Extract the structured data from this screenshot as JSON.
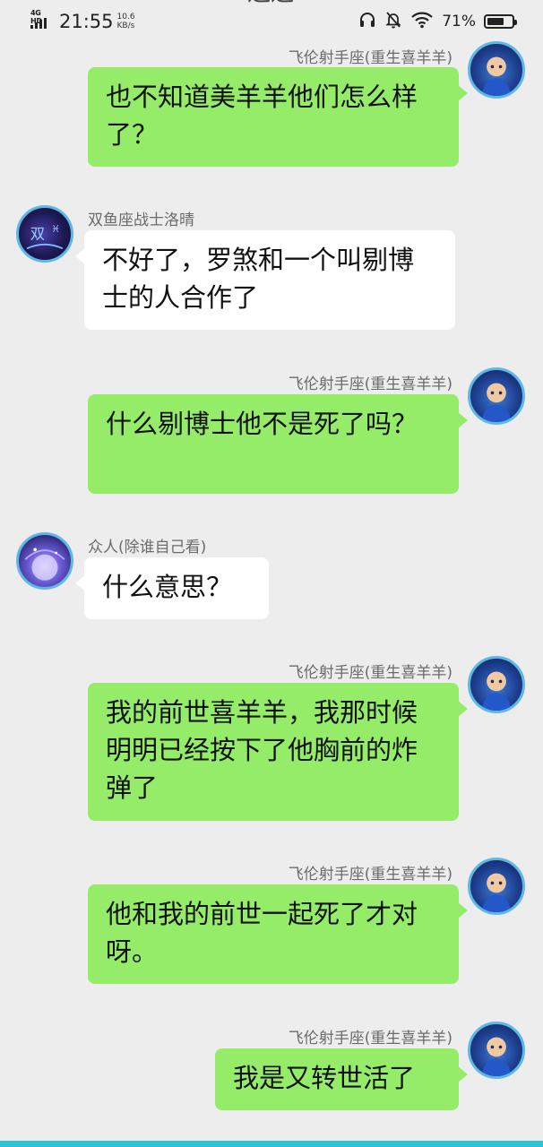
{
  "status_bar": {
    "network": "4G HD",
    "time": "21:55",
    "speed_value": "10.6",
    "speed_unit": "KB/s",
    "battery_pct": "71%",
    "battery_level": 0.71,
    "icons": [
      "headphones-icon",
      "bell-muted-icon",
      "wifi-icon",
      "battery-icon"
    ]
  },
  "chat": {
    "messages": [
      {
        "side": "right",
        "sender": "飞伦射手座(重生喜羊羊)",
        "text": "也不知道美羊羊他们怎么样了？",
        "avatar": "boy-avatar"
      },
      {
        "side": "left",
        "sender": "双鱼座战士洛晴",
        "text": "不好了，罗煞和一个叫剔博士的人合作了",
        "avatar": "pisces-avatar"
      },
      {
        "side": "right",
        "sender": "飞伦射手座(重生喜羊羊)",
        "text": "什么剔博士他不是死了吗？",
        "avatar": "boy-avatar"
      },
      {
        "side": "left",
        "sender": "众人(除谁自己看)",
        "text": "什么意思？",
        "avatar": "crowd-avatar"
      },
      {
        "side": "right",
        "sender": "飞伦射手座(重生喜羊羊)",
        "text": "我的前世喜羊羊，我那时候明明已经按下了他胸前的炸弹了",
        "avatar": "boy-avatar"
      },
      {
        "side": "right",
        "sender": "飞伦射手座(重生喜羊羊)",
        "text": "他和我的前世一起死了才对呀。",
        "avatar": "boy-avatar"
      },
      {
        "side": "right",
        "sender": "飞伦射手座(重生喜羊羊)",
        "text": "我是又转世活了",
        "avatar": "boy-avatar"
      }
    ]
  },
  "colors": {
    "background": "#ededed",
    "my_bubble": "#95ec69",
    "other_bubble": "#ffffff",
    "avatar_ring": "#5fb7e6",
    "bottom_accent": "#29c2d6"
  }
}
